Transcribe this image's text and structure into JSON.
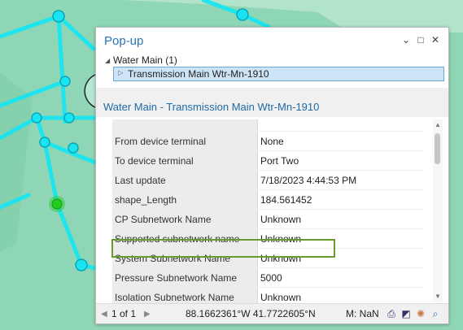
{
  "popup": {
    "title": "Pop-up",
    "controls": {
      "dropdown": "⌄",
      "maximize": "□",
      "close": "✕"
    }
  },
  "tree": {
    "root_label": "Water Main (1)",
    "child_label": "Transmission Main Wtr-Mn-1910"
  },
  "feature_title": "Water Main - Transmission Main Wtr-Mn-1910",
  "attributes": [
    {
      "name": "",
      "value": ""
    },
    {
      "name": "From device terminal",
      "value": "None"
    },
    {
      "name": "To device terminal",
      "value": "Port Two"
    },
    {
      "name": "Last update",
      "value": "7/18/2023 4:44:53 PM"
    },
    {
      "name": "shape_Length",
      "value": "184.561452"
    },
    {
      "name": "CP Subnetwork Name",
      "value": "Unknown"
    },
    {
      "name": "Supported subnetwork name",
      "value": "Unknown"
    },
    {
      "name": "System Subnetwork Name",
      "value": "Unknown"
    },
    {
      "name": "Pressure Subnetwork Name",
      "value": "5000"
    },
    {
      "name": "Isolation Subnetwork Name",
      "value": "Unknown"
    },
    {
      "name": "",
      "value": ""
    }
  ],
  "footer": {
    "prev": "◀",
    "page": "1 of 1",
    "next": "▶",
    "coordinates": "88.1662361°W 41.7722605°N",
    "measure": "M: NaN",
    "icons": [
      "print-icon",
      "export-icon",
      "flash-icon",
      "zoom-icon"
    ]
  },
  "colors": {
    "map_background": "#8fd6b6",
    "network_line": "#19e5f2",
    "selected_point": "#22cc22",
    "title_blue": "#2a74b8",
    "highlight_border": "#6a9a2c"
  }
}
